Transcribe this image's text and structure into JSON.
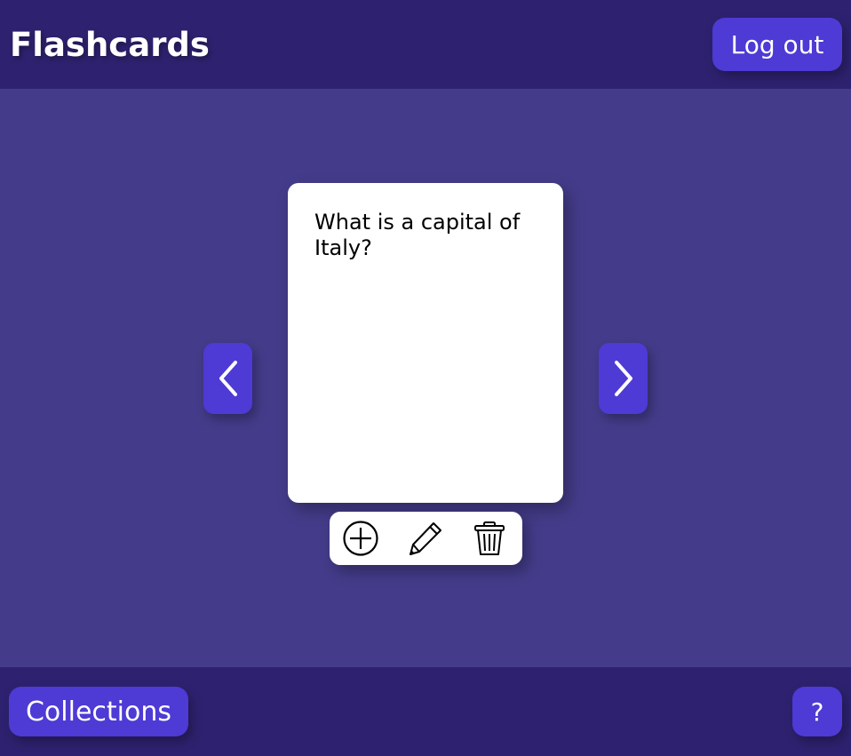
{
  "header": {
    "title": "Flashcards",
    "logout_label": "Log out"
  },
  "card": {
    "text": "What is a capital of Italy?"
  },
  "navigation": {
    "prev_icon": "chevron-left-icon",
    "next_icon": "chevron-right-icon"
  },
  "toolbar": {
    "add_icon": "plus-circle-icon",
    "edit_icon": "pencil-icon",
    "delete_icon": "trash-icon"
  },
  "footer": {
    "collections_label": "Collections",
    "help_label": "?"
  },
  "colors": {
    "bar_background": "#2e2270",
    "main_background": "#443c8a",
    "accent": "#4e3ad4",
    "card": "#ffffff"
  }
}
